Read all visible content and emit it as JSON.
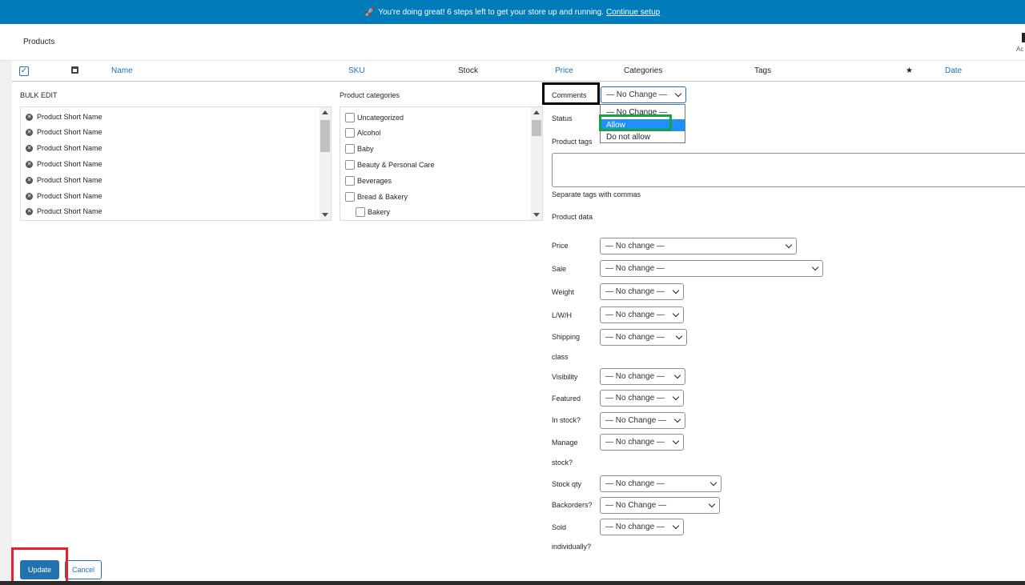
{
  "banner": {
    "icon": "rocket-icon",
    "message": "You're doing great! 6 steps left to get your store up and running.",
    "link": "Continue setup",
    "color": "#007cba"
  },
  "header": {
    "title": "Products",
    "activity_label": "Ac"
  },
  "columns": {
    "name": "Name",
    "sku": "SKU",
    "stock": "Stock",
    "price": "Price",
    "categories": "Categories",
    "tags": "Tags",
    "date": "Date",
    "checkbox_mark": "✓",
    "star": "★"
  },
  "bulk_edit": {
    "title": "BULK EDIT",
    "remove_icon": "✕",
    "items": [
      "Product Short Name",
      "Product Short Name",
      "Product Short Name",
      "Product Short Name",
      "Product Short Name",
      "Product Short Name",
      "Product Short Name"
    ]
  },
  "categories": {
    "title": "Product categories",
    "items": [
      "Uncategorized",
      "Alcohol",
      "Baby",
      "Beauty & Personal Care",
      "Beverages",
      "Bread & Bakery",
      "Bakery"
    ]
  },
  "comments": {
    "label": "Comments",
    "value": "— No Change —",
    "options": [
      "— No Change —",
      "Allow",
      "Do not allow"
    ],
    "highlighted": "Allow"
  },
  "status": {
    "label": "Status"
  },
  "tags": {
    "label": "Product tags",
    "hint": "Separate tags with commas",
    "value": ""
  },
  "product_data": {
    "title": "Product data",
    "fields": {
      "price": {
        "label": "Price",
        "value": "— No change —"
      },
      "sale": {
        "label": "Sale",
        "value": "— No change —"
      },
      "weight": {
        "label": "Weight",
        "value": "— No change —"
      },
      "lwh": {
        "label": "L/W/H",
        "value": "— No change —"
      },
      "shipping": {
        "label1": "Shipping",
        "label2": "class",
        "value": "— No change —"
      },
      "visibility": {
        "label": "Visibility",
        "value": "— No change —"
      },
      "featured": {
        "label": "Featured",
        "value": "— No change —"
      },
      "in_stock": {
        "label": "In stock?",
        "value": "— No Change —"
      },
      "manage": {
        "label1": "Manage",
        "label2": "stock?",
        "value": "— No change —"
      },
      "stock_qty": {
        "label": "Stock qty",
        "value": "— No change —"
      },
      "backorders": {
        "label": "Backorders?",
        "value": "— No Change —"
      },
      "sold": {
        "label1": "Sold",
        "label2": "individually?",
        "value": "— No change —"
      }
    }
  },
  "actions": {
    "update": "Update",
    "cancel": "Cancel"
  },
  "highlight_colors": {
    "comments": "#000000",
    "allow": "#1aa33a",
    "update": "#e0242f"
  }
}
